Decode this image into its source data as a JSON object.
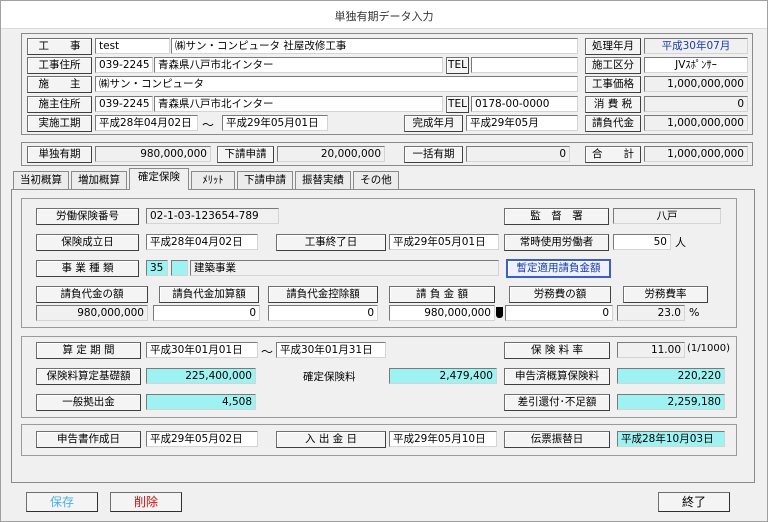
{
  "window": {
    "title": "単独有期データ入力"
  },
  "header": {
    "koji_label": "工　　事",
    "koji_code": "test",
    "koji_name": "㈱サン・コンピュータ 社屋改修工事",
    "koji_addr_label": "工事住所",
    "koji_zip": "039-2245",
    "koji_addr": "青森県八戸市北インター",
    "tel_label": "TEL",
    "koji_tel": "",
    "sesyu_label": "施　　主",
    "sesyu_name": "㈱サン・コンピュータ",
    "sesyu_addr_label": "施主住所",
    "sesyu_zip": "039-2245",
    "sesyu_addr": "青森県八戸市北インター",
    "sesyu_tel_label": "TEL",
    "sesyu_tel": "0178-00-0000",
    "period_label": "実施工期",
    "period_start": "平成28年04月02日",
    "period_tilde": "～",
    "period_end": "平成29年05月01日",
    "kansei_label": "完成年月",
    "kansei_value": "平成29年05月",
    "shori_label": "処理年月",
    "shori_value": "平成30年07月",
    "seko_label": "施工区分",
    "seko_value": "JVｽﾎﾟﾝｻｰ",
    "kakaku_label": "工事価格",
    "kakaku_value": "1,000,000,000",
    "zei_label": "消 費 税",
    "zei_value": "0",
    "ukeoi_label": "請負代金",
    "ukeoi_value": "1,000,000,000"
  },
  "summary": {
    "tandoku_label": "単独有期",
    "tandoku_value": "980,000,000",
    "shita_label": "下請申請",
    "shita_value": "20,000,000",
    "ikkatsu_label": "一括有期",
    "ikkatsu_value": "0",
    "gokei_label": "合　　計",
    "gokei_value": "1,000,000,000"
  },
  "tabs": [
    {
      "label": "当初概算"
    },
    {
      "label": "増加概算"
    },
    {
      "label": "確定保険"
    },
    {
      "label": "ﾒﾘｯﾄ"
    },
    {
      "label": "下請申請"
    },
    {
      "label": "振替実績"
    },
    {
      "label": "その他"
    }
  ],
  "kakutei": {
    "rodo_label": "労働保険番号",
    "rodo_value": "02-1-03-123654-789",
    "kantoku_label": "監　督　署",
    "kantoku_value": "八戸",
    "seiritsu_label": "保険成立日",
    "seiritsu_value": "平成28年04月02日",
    "shuryo_label": "工事終了日",
    "shuryo_value": "平成29年05月01日",
    "joji_label": "常時使用労働者",
    "joji_value": "50",
    "joji_unit": "人",
    "jigyo_label": "事 業 種 類",
    "jigyo_code": "35",
    "jigyo_name": "建築事業",
    "zantei_btn": "暫定適用請負金額",
    "cols": [
      "請負代金の額",
      "請負代金加算額",
      "請負代金控除額",
      "請 負 金 額",
      "労務費の額",
      "労務費率"
    ],
    "vals": [
      "980,000,000",
      "0",
      "0",
      "980,000,000",
      "0",
      "23.0"
    ],
    "pct_unit": "%",
    "santei_label": "算 定 期 間",
    "santei_start": "平成30年01月01日",
    "santei_tilde": "～",
    "santei_end": "平成30年01月31日",
    "ritsu_label": "保 険 料 率",
    "ritsu_value": "11.00",
    "ritsu_unit": "(1/1000)",
    "kiso_label": "保険料算定基礎額",
    "kiso_value": "225,400,000",
    "kakutei_label": "確定保険料",
    "kakutei_value": "2,479,400",
    "shinkoku_label": "申告済概算保険料",
    "shinkoku_value": "220,220",
    "ippan_label": "一般拠出金",
    "ippan_value": "4,508",
    "sashihiki_label": "差引還付･不足額",
    "sashihiki_value": "2,259,180",
    "sakusei_label": "申告書作成日",
    "sakusei_value": "平成29年05月02日",
    "nyushutsu_label": "入 出 金 日",
    "nyushutsu_value": "平成29年05月10日",
    "denpyo_label": "伝票振替日",
    "denpyo_value": "平成28年10月03日"
  },
  "footer": {
    "save_label": "保存",
    "delete_label": "削除",
    "exit_label": "終了"
  },
  "colors": {
    "cyan_field": "#9ff2f2",
    "save_text": "#4ab0e8",
    "delete_text": "#d01010"
  }
}
